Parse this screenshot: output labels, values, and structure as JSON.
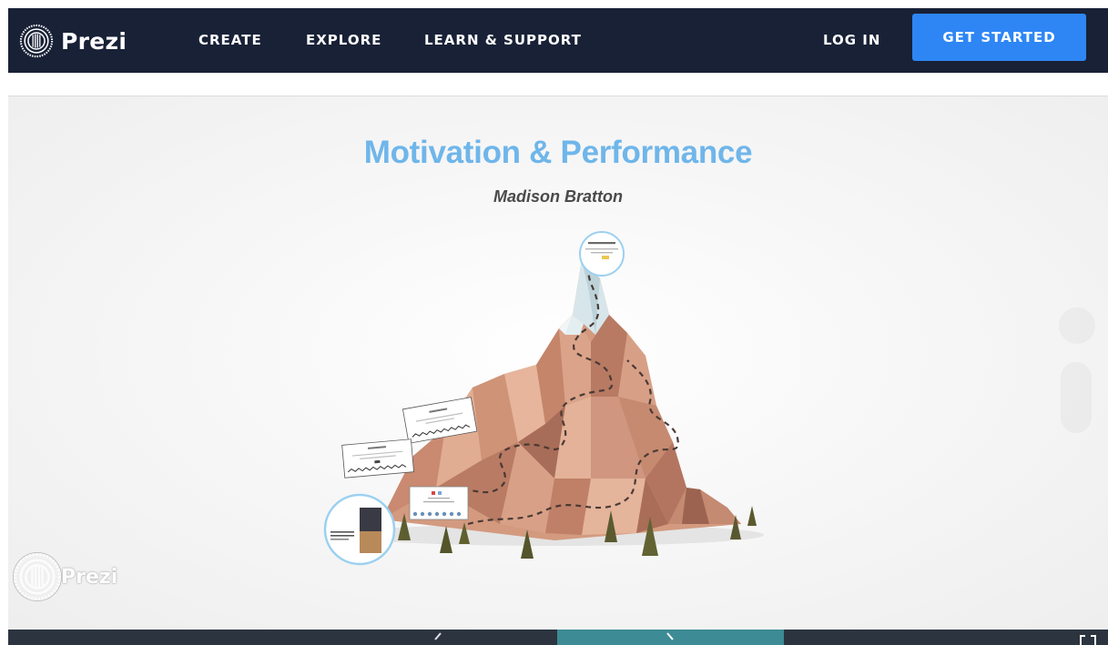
{
  "header": {
    "brand": "Prezi",
    "nav": [
      "CREATE",
      "EXPLORE",
      "LEARN & SUPPORT"
    ],
    "login_label": "LOG IN",
    "cta_label": "GET STARTED",
    "colors": {
      "bar": "#182136",
      "cta": "#2e86f5"
    }
  },
  "presentation": {
    "title": "Motivation & Performance",
    "subtitle": "Madison Bratton",
    "watermark": "Prezi",
    "title_color": "#6fb6ea"
  },
  "player": {
    "prev_icon": "chevron-left-icon",
    "next_icon": "chevron-right-icon",
    "fullscreen_icon": "fullscreen-icon"
  }
}
